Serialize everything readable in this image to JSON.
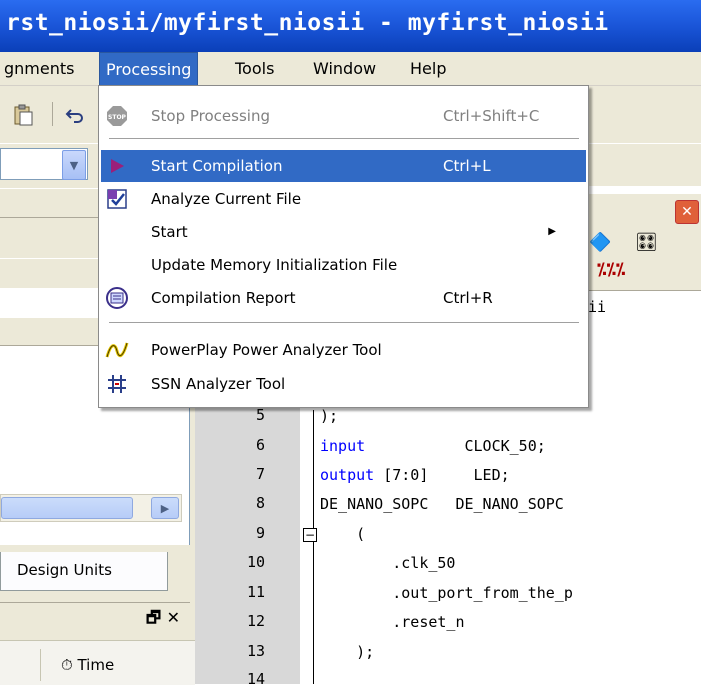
{
  "window": {
    "title": "rst_niosii/myfirst_niosii - myfirst_niosii"
  },
  "menubar": {
    "items": [
      "gnments",
      "Processing",
      "Tools",
      "Window",
      "Help"
    ]
  },
  "processing_menu": {
    "items": [
      {
        "label": "Stop Processing",
        "shortcut": "Ctrl+Shift+C",
        "icon": "stop-icon",
        "disabled": true
      },
      {
        "label": "Start Compilation",
        "shortcut": "Ctrl+L",
        "icon": "play-triangle-icon",
        "highlighted": true
      },
      {
        "label": "Analyze Current File",
        "shortcut": "",
        "icon": "analyze-file-icon"
      },
      {
        "label": "Start",
        "shortcut": "",
        "icon": "",
        "submenu": true
      },
      {
        "label": "Update Memory Initialization File",
        "shortcut": "",
        "icon": ""
      },
      {
        "label": "Compilation Report",
        "shortcut": "Ctrl+R",
        "icon": "compilation-report-icon"
      },
      {
        "label": "PowerPlay Power Analyzer Tool",
        "shortcut": "",
        "icon": "powerplay-icon"
      },
      {
        "label": "SSN Analyzer Tool",
        "shortcut": "",
        "icon": "ssn-analyzer-icon"
      }
    ],
    "colors": {
      "highlight": "#316ac5"
    }
  },
  "left_pane": {
    "design_units_tab": "Design Units",
    "time_column": "Time"
  },
  "editor": {
    "partial_text_top": "sii",
    "lines": [
      {
        "num": "5",
        "code": ");"
      },
      {
        "num": "6",
        "kw": "input",
        "rest": "           CLOCK_50;"
      },
      {
        "num": "7",
        "kw": "output",
        "rest": " [7:0]     LED;"
      },
      {
        "num": "8",
        "code": "DE_NANO_SOPC   DE_NANO_SOPC"
      },
      {
        "num": "9",
        "code": "    ("
      },
      {
        "num": "10",
        "code": "        .clk_50"
      },
      {
        "num": "11",
        "code": "        .out_port_from_the_p"
      },
      {
        "num": "12",
        "code": "        .reset_n"
      },
      {
        "num": "13",
        "code": "    );"
      },
      {
        "num": "14",
        "code": ""
      }
    ]
  }
}
